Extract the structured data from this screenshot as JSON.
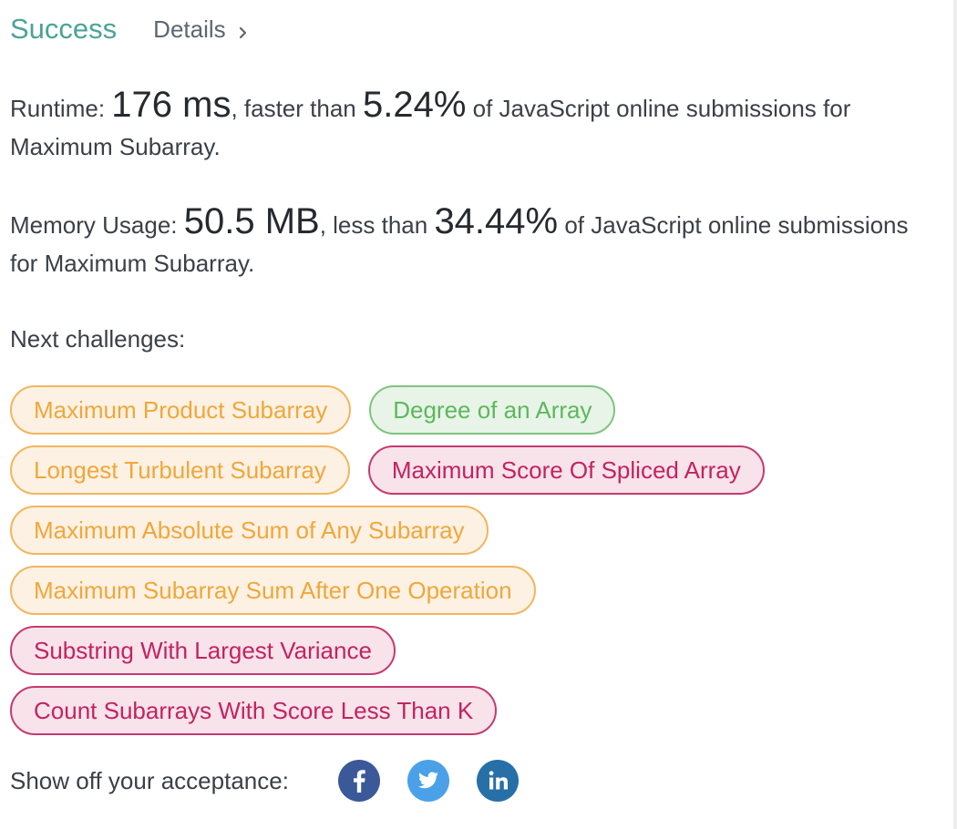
{
  "result": {
    "status": "Success",
    "details_label": "Details"
  },
  "runtime": {
    "label": "Runtime: ",
    "value": "176 ms",
    "comparator": ", faster than ",
    "percent": "5.24%",
    "suffix": " of JavaScript online submissions for Maximum Subarray."
  },
  "memory": {
    "label": "Memory Usage: ",
    "value": "50.5 MB",
    "comparator": ", less than ",
    "percent": "34.44%",
    "suffix": " of JavaScript online submissions for Maximum Subarray."
  },
  "next_challenges": {
    "heading": "Next challenges:",
    "items": [
      {
        "title": "Maximum Product Subarray",
        "difficulty": "medium"
      },
      {
        "title": "Degree of an Array",
        "difficulty": "easy"
      },
      {
        "title": "Longest Turbulent Subarray",
        "difficulty": "medium"
      },
      {
        "title": "Maximum Score Of Spliced Array",
        "difficulty": "hard"
      },
      {
        "title": "Maximum Absolute Sum of Any Subarray",
        "difficulty": "medium"
      },
      {
        "title": "Maximum Subarray Sum After One Operation",
        "difficulty": "medium"
      },
      {
        "title": "Substring With Largest Variance",
        "difficulty": "hard"
      },
      {
        "title": "Count Subarrays With Score Less Than K",
        "difficulty": "hard"
      }
    ]
  },
  "share": {
    "label": "Show off your acceptance:",
    "icons": [
      "facebook-icon",
      "twitter-icon",
      "linkedin-icon"
    ]
  },
  "colors": {
    "success": "#4aa497",
    "medium": "#f0a73b",
    "easy": "#5cb85c",
    "hard": "#c22361",
    "facebook": "#3b5998",
    "twitter": "#4ba1e8",
    "linkedin": "#276fa7"
  }
}
